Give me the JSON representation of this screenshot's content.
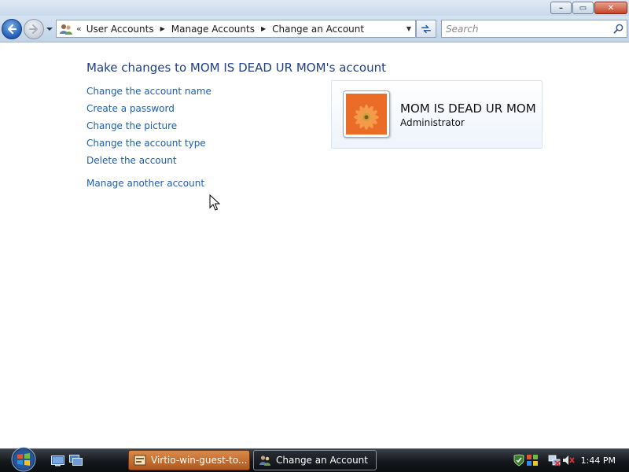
{
  "titlebar": {
    "buttons": {
      "minimize": "–",
      "maximize": "▭",
      "close": "✕"
    }
  },
  "navbar": {
    "address_overflow": "«",
    "breadcrumbs": [
      "User Accounts",
      "Manage Accounts",
      "Change an Account"
    ],
    "search_placeholder": "Search"
  },
  "content": {
    "heading": "Make changes to MOM IS DEAD UR MOM's account",
    "tasks": [
      "Change the account name",
      "Create a password",
      "Change the picture",
      "Change the account type",
      "Delete the account"
    ],
    "other_task": "Manage another account",
    "account": {
      "name": "MOM IS DEAD UR MOM",
      "type": "Administrator"
    }
  },
  "taskbar": {
    "windows": [
      "Virtio-win-guest-to...",
      "Change an Account"
    ],
    "clock": "1:44 PM"
  },
  "colors": {
    "link": "#1a5fb4",
    "heading": "#1e3f8a",
    "navbar": "#c9d9ea",
    "taskbar": "#14171b",
    "virtio_button": "#c4703a"
  }
}
